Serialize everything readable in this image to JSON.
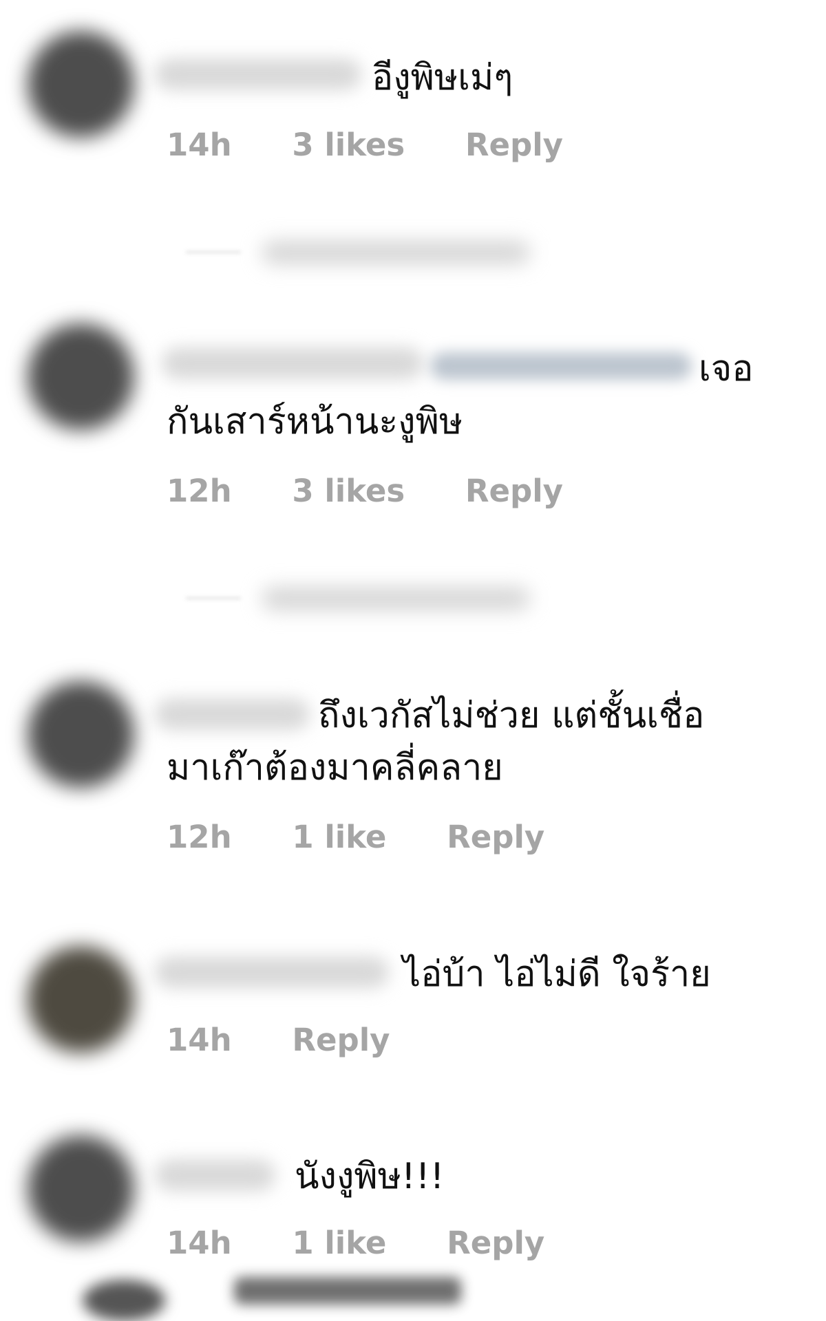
{
  "comments": [
    {
      "text_lines": [
        "อีงูพิษเม่ๆ"
      ],
      "time": "14h",
      "likes": "3 likes",
      "reply": "Reply"
    },
    {
      "text_lines": [
        "เจอ",
        "กันเสาร์หน้านะงูพิษ"
      ],
      "time": "12h",
      "likes": "3 likes",
      "reply": "Reply"
    },
    {
      "text_lines": [
        "ถึงเวกัสไม่ช่วย แต่ชั้นเชื่อ",
        "มาเก๊าต้องมาคลี่คลาย"
      ],
      "time": "12h",
      "likes": "1 like",
      "reply": "Reply"
    },
    {
      "text_lines": [
        "ไอ่บ้า ไอ่ไม่ดี ใจร้าย"
      ],
      "time": "14h",
      "reply": "Reply"
    },
    {
      "text_lines": [
        "นังงูพิษ!!!"
      ],
      "time": "14h",
      "likes": "1 like",
      "reply": "Reply"
    }
  ],
  "icons": {
    "avatar": "blurred-avatar"
  }
}
